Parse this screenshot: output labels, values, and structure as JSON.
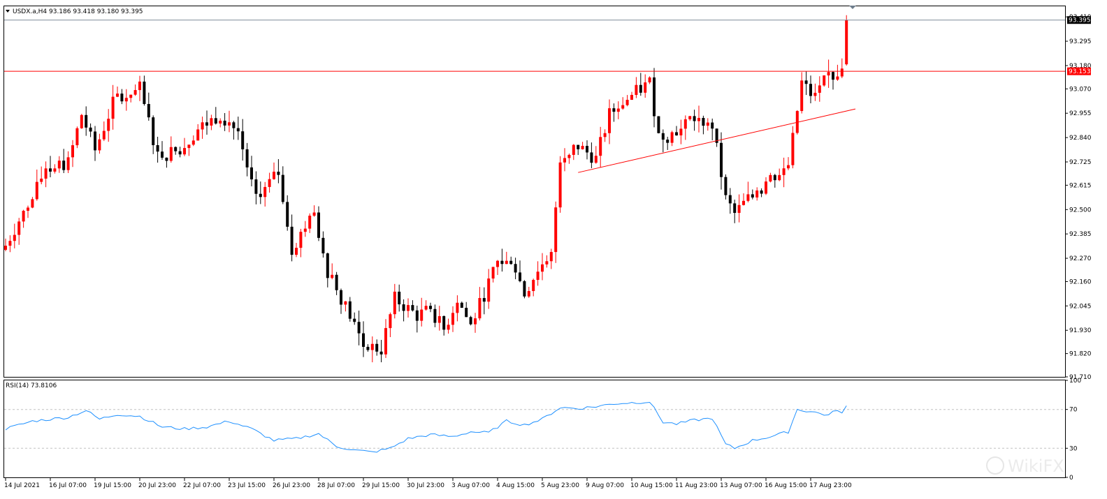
{
  "colors": {
    "bull": "#ff0000",
    "bear": "#000000",
    "rsi": "#1e90ff",
    "trendline": "#ff0000",
    "bid_line": "#7f8c99",
    "grid": "#c0c0c0"
  },
  "main_panel": {
    "symbol_header": "USDX.a,H4  93.186 93.418 93.180 93.395",
    "current_price_label": "93.395",
    "horizontal_line_label": "93.153"
  },
  "rsi_panel": {
    "header": "RSI(14) 73.8106"
  },
  "watermark": "WikiFX",
  "chart_data": [
    {
      "type": "candlestick",
      "title": "USDX.a,H4",
      "ylim": [
        91.71,
        93.46
      ],
      "y_ticks": [
        "93.410",
        "93.295",
        "93.180",
        "93.070",
        "92.955",
        "92.840",
        "92.725",
        "92.615",
        "92.500",
        "92.385",
        "92.270",
        "92.160",
        "92.045",
        "91.930",
        "91.820",
        "91.710"
      ],
      "x_ticks": [
        {
          "label": "14 Jul 2021",
          "index": 0
        },
        {
          "label": "16 Jul 07:00",
          "index": 10
        },
        {
          "label": "19 Jul 15:00",
          "index": 20
        },
        {
          "label": "20 Jul 23:00",
          "index": 30
        },
        {
          "label": "22 Jul 07:00",
          "index": 40
        },
        {
          "label": "23 Jul 15:00",
          "index": 50
        },
        {
          "label": "26 Jul 23:00",
          "index": 60
        },
        {
          "label": "28 Jul 07:00",
          "index": 70
        },
        {
          "label": "29 Jul 15:00",
          "index": 80
        },
        {
          "label": "30 Jul 23:00",
          "index": 90
        },
        {
          "label": "3 Aug 07:00",
          "index": 100
        },
        {
          "label": "4 Aug 15:00",
          "index": 110
        },
        {
          "label": "5 Aug 23:00",
          "index": 120
        },
        {
          "label": "9 Aug 07:00",
          "index": 130
        },
        {
          "label": "10 Aug 15:00",
          "index": 140
        },
        {
          "label": "11 Aug 23:00",
          "index": 150
        },
        {
          "label": "13 Aug 07:00",
          "index": 160
        },
        {
          "label": "16 Aug 15:00",
          "index": 170
        },
        {
          "label": "17 Aug 23:00",
          "index": 180
        }
      ],
      "anchors": [
        {
          "i": 0,
          "p": 92.33
        },
        {
          "i": 3,
          "p": 92.45
        },
        {
          "i": 6,
          "p": 92.55
        },
        {
          "i": 9,
          "p": 92.7
        },
        {
          "i": 14,
          "p": 92.72
        },
        {
          "i": 17,
          "p": 92.95
        },
        {
          "i": 20,
          "p": 92.78
        },
        {
          "i": 24,
          "p": 93.0
        },
        {
          "i": 30,
          "p": 93.07
        },
        {
          "i": 34,
          "p": 92.76
        },
        {
          "i": 39,
          "p": 92.78
        },
        {
          "i": 43,
          "p": 92.88
        },
        {
          "i": 48,
          "p": 92.95
        },
        {
          "i": 52,
          "p": 92.87
        },
        {
          "i": 56,
          "p": 92.54
        },
        {
          "i": 61,
          "p": 92.68
        },
        {
          "i": 64,
          "p": 92.32
        },
        {
          "i": 69,
          "p": 92.48
        },
        {
          "i": 72,
          "p": 92.21
        },
        {
          "i": 77,
          "p": 92.0
        },
        {
          "i": 80,
          "p": 91.86
        },
        {
          "i": 84,
          "p": 91.84
        },
        {
          "i": 87,
          "p": 92.08
        },
        {
          "i": 92,
          "p": 92.0
        },
        {
          "i": 95,
          "p": 92.03
        },
        {
          "i": 98,
          "p": 91.93
        },
        {
          "i": 101,
          "p": 92.08
        },
        {
          "i": 104,
          "p": 91.95
        },
        {
          "i": 107,
          "p": 92.1
        },
        {
          "i": 110,
          "p": 92.25
        },
        {
          "i": 113,
          "p": 92.28
        },
        {
          "i": 116,
          "p": 92.1
        },
        {
          "i": 119,
          "p": 92.22
        },
        {
          "i": 122,
          "p": 92.28
        },
        {
          "i": 124,
          "p": 92.75
        },
        {
          "i": 128,
          "p": 92.8
        },
        {
          "i": 132,
          "p": 92.74
        },
        {
          "i": 135,
          "p": 92.95
        },
        {
          "i": 140,
          "p": 93.04
        },
        {
          "i": 144,
          "p": 93.1
        },
        {
          "i": 146,
          "p": 92.85
        },
        {
          "i": 150,
          "p": 92.86
        },
        {
          "i": 154,
          "p": 92.93
        },
        {
          "i": 158,
          "p": 92.9
        },
        {
          "i": 161,
          "p": 92.55
        },
        {
          "i": 163,
          "p": 92.48
        },
        {
          "i": 168,
          "p": 92.6
        },
        {
          "i": 171,
          "p": 92.65
        },
        {
          "i": 175,
          "p": 92.7
        },
        {
          "i": 178,
          "p": 93.1
        },
        {
          "i": 181,
          "p": 93.02
        },
        {
          "i": 184,
          "p": 93.14
        },
        {
          "i": 186,
          "p": 93.12
        },
        {
          "i": 187,
          "p": 93.186
        },
        {
          "i": 188,
          "p": 93.395
        }
      ],
      "last_candle": {
        "open": 93.186,
        "high": 93.418,
        "low": 93.18,
        "close": 93.395
      },
      "horizontal_line": 93.153,
      "trendline": {
        "start": {
          "index": 128,
          "price": 92.675
        },
        "end": {
          "index": 190,
          "price": 92.975
        }
      }
    },
    {
      "type": "line",
      "title": "RSI(14) 73.8106",
      "ylim": [
        0,
        100
      ],
      "y_ticks": [
        "100",
        "70",
        "30",
        "0"
      ],
      "levels": [
        70,
        30
      ],
      "series": [
        {
          "name": "RSI(14)",
          "anchors": [
            {
              "i": 0,
              "v": 50
            },
            {
              "i": 6,
              "v": 58
            },
            {
              "i": 10,
              "v": 60
            },
            {
              "i": 14,
              "v": 62
            },
            {
              "i": 18,
              "v": 69
            },
            {
              "i": 21,
              "v": 60
            },
            {
              "i": 25,
              "v": 65
            },
            {
              "i": 30,
              "v": 63
            },
            {
              "i": 35,
              "v": 52
            },
            {
              "i": 40,
              "v": 50
            },
            {
              "i": 45,
              "v": 52
            },
            {
              "i": 50,
              "v": 58
            },
            {
              "i": 55,
              "v": 50
            },
            {
              "i": 60,
              "v": 38
            },
            {
              "i": 65,
              "v": 40
            },
            {
              "i": 70,
              "v": 45
            },
            {
              "i": 74,
              "v": 32
            },
            {
              "i": 78,
              "v": 28
            },
            {
              "i": 82,
              "v": 26
            },
            {
              "i": 86,
              "v": 30
            },
            {
              "i": 90,
              "v": 40
            },
            {
              "i": 95,
              "v": 44
            },
            {
              "i": 100,
              "v": 42
            },
            {
              "i": 104,
              "v": 47
            },
            {
              "i": 108,
              "v": 46
            },
            {
              "i": 112,
              "v": 58
            },
            {
              "i": 116,
              "v": 54
            },
            {
              "i": 120,
              "v": 60
            },
            {
              "i": 124,
              "v": 72
            },
            {
              "i": 128,
              "v": 71
            },
            {
              "i": 132,
              "v": 73
            },
            {
              "i": 136,
              "v": 76
            },
            {
              "i": 140,
              "v": 77
            },
            {
              "i": 144,
              "v": 78
            },
            {
              "i": 147,
              "v": 57
            },
            {
              "i": 150,
              "v": 55
            },
            {
              "i": 154,
              "v": 59
            },
            {
              "i": 158,
              "v": 61
            },
            {
              "i": 161,
              "v": 34
            },
            {
              "i": 163,
              "v": 30
            },
            {
              "i": 167,
              "v": 38
            },
            {
              "i": 171,
              "v": 42
            },
            {
              "i": 175,
              "v": 47
            },
            {
              "i": 177,
              "v": 70
            },
            {
              "i": 181,
              "v": 67
            },
            {
              "i": 184,
              "v": 64
            },
            {
              "i": 186,
              "v": 70
            },
            {
              "i": 187,
              "v": 66
            },
            {
              "i": 188,
              "v": 73.81
            }
          ]
        }
      ]
    }
  ]
}
